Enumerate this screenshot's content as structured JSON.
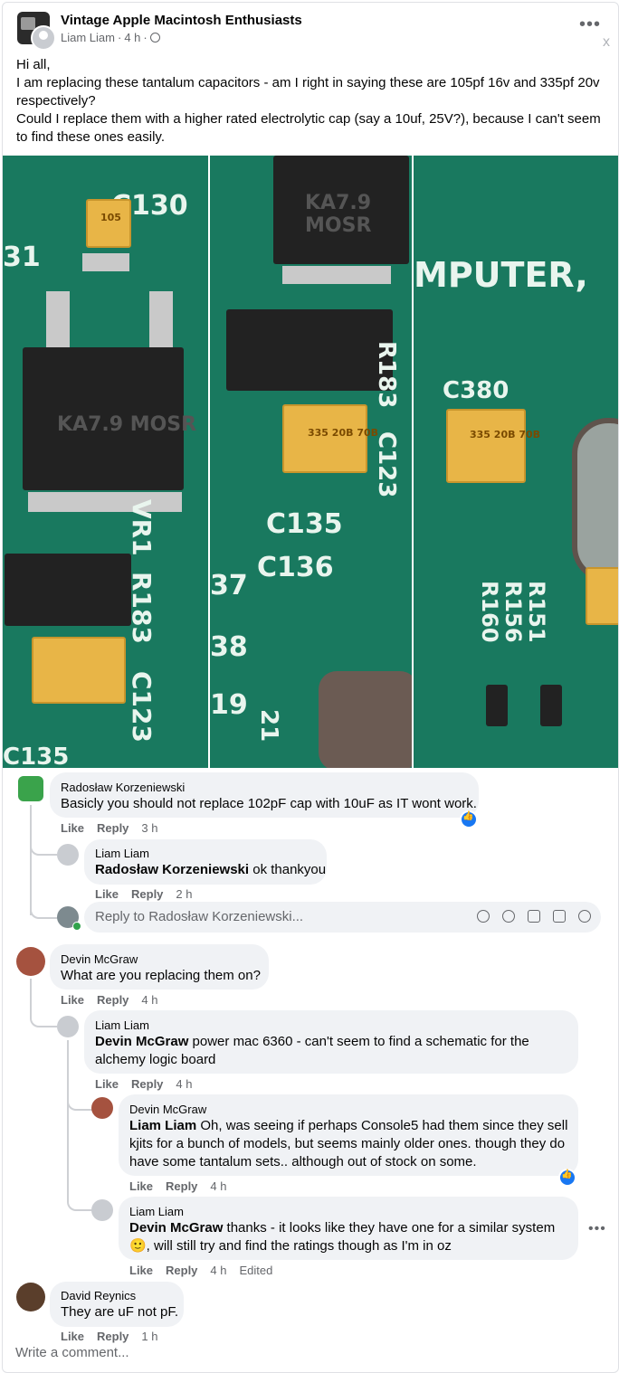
{
  "post": {
    "group_name": "Vintage Apple Macintosh Enthusiasts",
    "author": "Liam Liam",
    "time": "4 h",
    "text": [
      "Hi all,",
      "I am replacing these tantalum capacitors - am I right in saying these are 105pf 16v and 335pf 20v respectively?",
      "Could I replace them with a higher rated electrolytic cap (say a 10uf, 25V?), because I can't seem to find these ones easily."
    ],
    "more_icon": "more-options-icon",
    "close_label": "x"
  },
  "photos": [
    {
      "labels": [
        "C130",
        "31",
        "VR1",
        "R183",
        "C123",
        "C135"
      ],
      "chip_text": "105",
      "ic_text": "KA7.9 MOSR"
    },
    {
      "labels": [
        "R183",
        "C123",
        "C135",
        "C136",
        "37",
        "38",
        "21",
        "19"
      ],
      "chip_text": "335 20B 70B",
      "ic_text": "KA7.9 MOSR"
    },
    {
      "labels": [
        "MPUTER,",
        "C380",
        "R151",
        "R156",
        "R160"
      ],
      "chip_text": "335 20B 70B"
    }
  ],
  "comments": {
    "c1": {
      "name": "Radosław Korzeniewski",
      "text": "Basicly you should not replace 102pF cap with 10uF as IT wont work.",
      "like": "Like",
      "reply": "Reply",
      "time": "3 h"
    },
    "c1r1": {
      "name": "Liam Liam",
      "mention": "Radosław Korzeniewski",
      "text": " ok thankyou",
      "like": "Like",
      "reply": "Reply",
      "time": "2 h"
    },
    "reply_box": {
      "placeholder": "Reply to Radosław Korzeniewski..."
    },
    "c2": {
      "name": "Devin McGraw",
      "text": "What are you replacing them on?",
      "like": "Like",
      "reply": "Reply",
      "time": "4 h"
    },
    "c2r1": {
      "name": "Liam Liam",
      "mention": "Devin McGraw",
      "line1": " power mac 6360 - can't seem to find a schematic for the",
      "line2": "alchemy logic board",
      "like": "Like",
      "reply": "Reply",
      "time": "4 h"
    },
    "c2r2": {
      "name": "Devin McGraw",
      "mention": "Liam Liam",
      "line1": " Oh, was seeing if perhaps Console5 had them since they sell",
      "line2": "kjits for a bunch of models, but seems mainly older ones. though they do",
      "line3": "have some tantalum sets.. although out of stock on some.",
      "like": "Like",
      "reply": "Reply",
      "time": "4 h"
    },
    "c2r3": {
      "name": "Liam Liam",
      "mention": "Devin McGraw",
      "line1": " thanks - it looks like they have one for a similar system",
      "line2": "🙂, will still try and find the ratings though as I'm in oz",
      "like": "Like",
      "reply": "Reply",
      "time": "4 h",
      "edited": "Edited"
    },
    "c3": {
      "name": "David Reynics",
      "text": "They are uF not pF.",
      "like": "Like",
      "reply": "Reply",
      "time": "1 h"
    }
  },
  "write_comment": {
    "placeholder": "Write a comment..."
  }
}
